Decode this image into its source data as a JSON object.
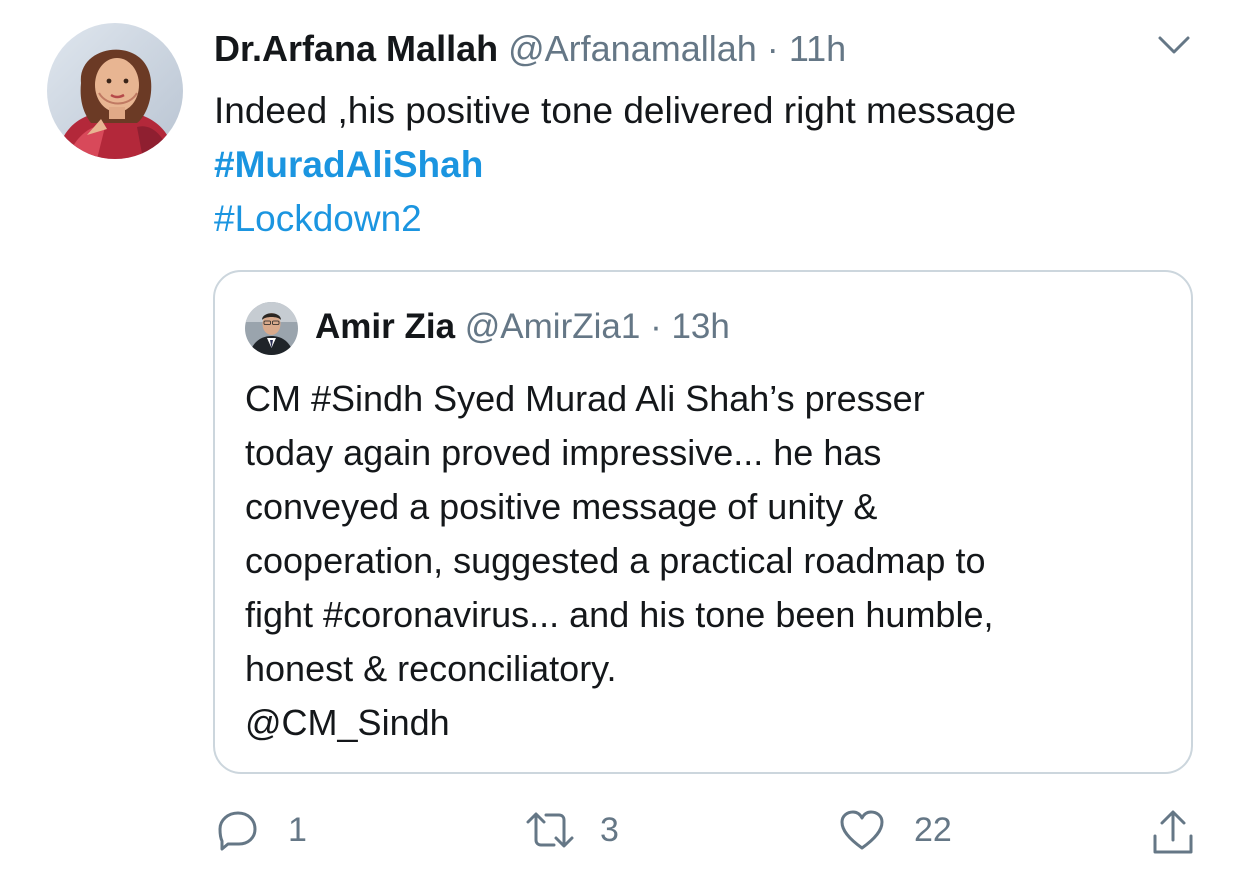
{
  "tweet": {
    "author_name": "Dr.Arfana Mallah",
    "author_handle": "@Arfanamallah",
    "separator": "·",
    "time": "11h",
    "text_line1": "Indeed ,his positive tone delivered right message",
    "hashtag1": "#MuradAliShah",
    "hashtag2": "#Lockdown2",
    "more_icon": "chevron-down-icon"
  },
  "quoted": {
    "author_name": "Amir Zia",
    "author_handle": "@AmirZia1",
    "separator": "·",
    "time": "13h",
    "lines": [
      "CM #Sindh Syed Murad Ali Shah’s presser",
      "today again proved impressive... he has",
      "conveyed a positive message of unity &",
      "cooperation, suggested a practical roadmap to",
      "fight #coronavirus... and his tone been humble,",
      "honest & reconciliatory.",
      "@CM_Sindh"
    ]
  },
  "actions": {
    "reply_count": "1",
    "retweet_count": "3",
    "like_count": "22",
    "reply_icon": "reply-icon",
    "retweet_icon": "retweet-icon",
    "like_icon": "heart-icon",
    "share_icon": "share-icon"
  },
  "colors": {
    "link": "#1b95e0",
    "muted": "#657786",
    "text": "#14171a",
    "border": "#ccd6dd"
  }
}
